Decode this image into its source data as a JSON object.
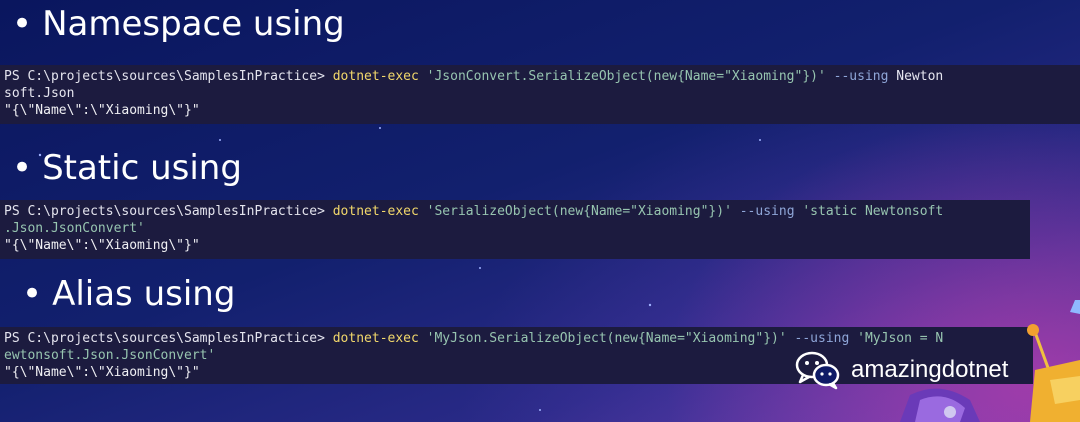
{
  "sections": [
    {
      "heading": "Namespace using",
      "lines": [
        [
          {
            "t": "PS C:\\projects\\sources\\SamplesInPractice> ",
            "c": "prompt"
          },
          {
            "t": "dotnet-exec",
            "c": "cmd"
          },
          {
            "t": " 'JsonConvert.SerializeObject(new{Name=\"Xiaoming\"})'",
            "c": "str"
          },
          {
            "t": " --using",
            "c": "flag"
          },
          {
            "t": " Newton",
            "c": "plain"
          }
        ],
        [
          {
            "t": "soft.Json",
            "c": "plain"
          }
        ],
        [
          {
            "t": "\"{\\\"Name\\\":\\\"Xiaoming\\\"}\"",
            "c": "out"
          }
        ]
      ]
    },
    {
      "heading": "Static using",
      "lines": [
        [
          {
            "t": "PS C:\\projects\\sources\\SamplesInPractice> ",
            "c": "prompt"
          },
          {
            "t": "dotnet-exec",
            "c": "cmd"
          },
          {
            "t": " 'SerializeObject(new{Name=\"Xiaoming\"})'",
            "c": "str"
          },
          {
            "t": " --using",
            "c": "flag"
          },
          {
            "t": " 'static Newtonsoft",
            "c": "str"
          }
        ],
        [
          {
            "t": ".Json.JsonConvert'",
            "c": "str"
          }
        ],
        [
          {
            "t": "\"{\\\"Name\\\":\\\"Xiaoming\\\"}\"",
            "c": "out"
          }
        ]
      ]
    },
    {
      "heading": "Alias using",
      "lines": [
        [
          {
            "t": "PS C:\\projects\\sources\\SamplesInPractice> ",
            "c": "prompt"
          },
          {
            "t": "dotnet-exec",
            "c": "cmd"
          },
          {
            "t": " 'MyJson.SerializeObject(new{Name=\"Xiaoming\"})'",
            "c": "str"
          },
          {
            "t": " --using",
            "c": "flag"
          },
          {
            "t": " 'MyJson = N",
            "c": "str"
          }
        ],
        [
          {
            "t": "ewtonsoft.Json.JsonConvert'",
            "c": "str"
          }
        ],
        [
          {
            "t": "\"{\\\"Name\\\":\\\"Xiaoming\\\"}\"",
            "c": "out"
          }
        ]
      ]
    }
  ],
  "bullet": "•",
  "watermark": {
    "icon": "wechat-icon",
    "text": "amazingdotnet"
  },
  "colors": {
    "command": "#f2d86b",
    "string": "#97c5b0",
    "flag": "#8fa6d8",
    "terminal_bg": "#1c1b3f",
    "slide_bg": "#0e1a66"
  }
}
